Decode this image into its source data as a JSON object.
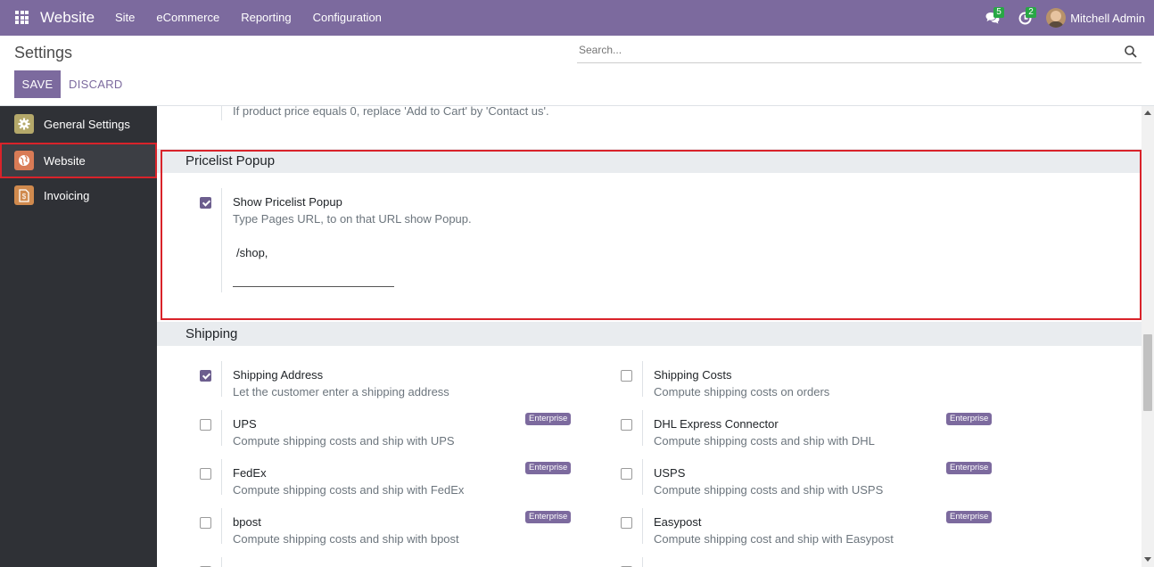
{
  "navbar": {
    "app_name": "Website",
    "menu": [
      "Site",
      "eCommerce",
      "Reporting",
      "Configuration"
    ],
    "messages_count": "5",
    "activities_count": "2",
    "user_name": "Mitchell Admin"
  },
  "control_panel": {
    "title": "Settings",
    "search_placeholder": "Search...",
    "save_label": "SAVE",
    "discard_label": "DISCARD"
  },
  "sidebar": {
    "items": [
      {
        "label": "General Settings",
        "icon": "gear-icon",
        "color": "#b4a86a"
      },
      {
        "label": "Website",
        "icon": "globe-icon",
        "color": "#d97b56",
        "active": true
      },
      {
        "label": "Invoicing",
        "icon": "invoice-icon",
        "color": "#d08a4e"
      }
    ]
  },
  "content": {
    "prev_desc": "If product price equals 0, replace 'Add to Cart' by 'Contact us'.",
    "pricelist": {
      "title": "Pricelist Popup",
      "label": "Show Pricelist Popup",
      "desc": "Type Pages URL, to on that URL show Popup.",
      "value": "/shop,",
      "checked": true
    },
    "shipping": {
      "title": "Shipping",
      "enterprise_badge": "Enterprise",
      "left": [
        {
          "label": "Shipping Address",
          "desc": "Let the customer enter a shipping address",
          "checked": true,
          "enterprise": false
        },
        {
          "label": "UPS",
          "desc": "Compute shipping costs and ship with UPS",
          "checked": false,
          "enterprise": true
        },
        {
          "label": "FedEx",
          "desc": "Compute shipping costs and ship with FedEx",
          "checked": false,
          "enterprise": true
        },
        {
          "label": "bpost",
          "desc": "Compute shipping costs and ship with bpost",
          "checked": false,
          "enterprise": true
        }
      ],
      "right": [
        {
          "label": "Shipping Costs",
          "desc": "Compute shipping costs on orders",
          "checked": false,
          "enterprise": false
        },
        {
          "label": "DHL Express Connector",
          "desc": "Compute shipping costs and ship with DHL",
          "checked": false,
          "enterprise": true
        },
        {
          "label": "USPS",
          "desc": "Compute shipping costs and ship with USPS",
          "checked": false,
          "enterprise": true
        },
        {
          "label": "Easypost",
          "desc": "Compute shipping cost and ship with Easypost",
          "checked": false,
          "enterprise": true
        }
      ]
    }
  },
  "colors": {
    "brand": "#7c6a9e",
    "highlight": "#d9232a",
    "sidebar_bg": "#2f3136"
  }
}
